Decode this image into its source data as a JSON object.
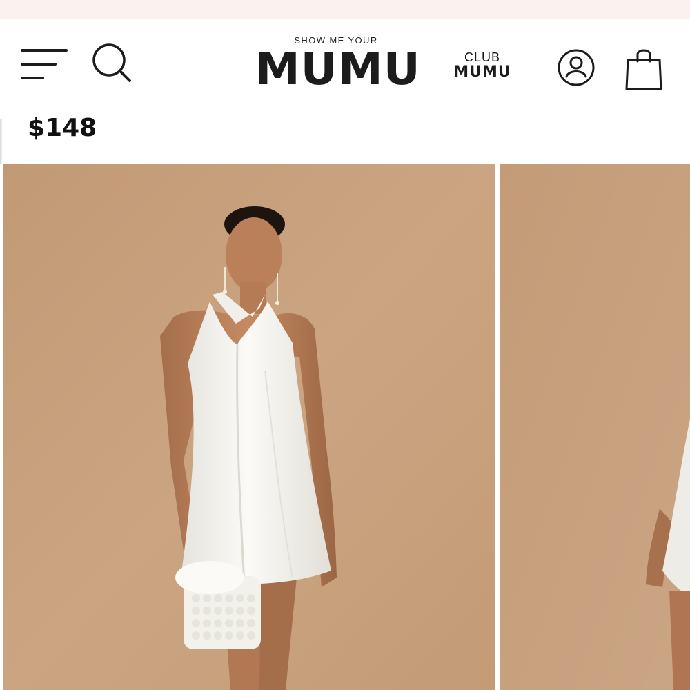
{
  "header": {
    "logo_tagline": "SHOW ME YOUR",
    "logo_main": "MUMU",
    "club_top": "CLUB",
    "club_bottom": "MUMU",
    "icons": {
      "menu": "hamburger-menu-icon",
      "search": "search-icon",
      "account": "account-icon",
      "cart": "shopping-bag-icon"
    }
  },
  "product": {
    "price": "$148",
    "gallery": {
      "images": [
        {
          "alt": "model-front"
        },
        {
          "alt": "model-side"
        }
      ]
    }
  },
  "colors": {
    "promo_bar": "#fbf2f0",
    "backdrop": "#c8a17d",
    "text": "#1c1c1c",
    "dress": "#f4f3ef"
  }
}
